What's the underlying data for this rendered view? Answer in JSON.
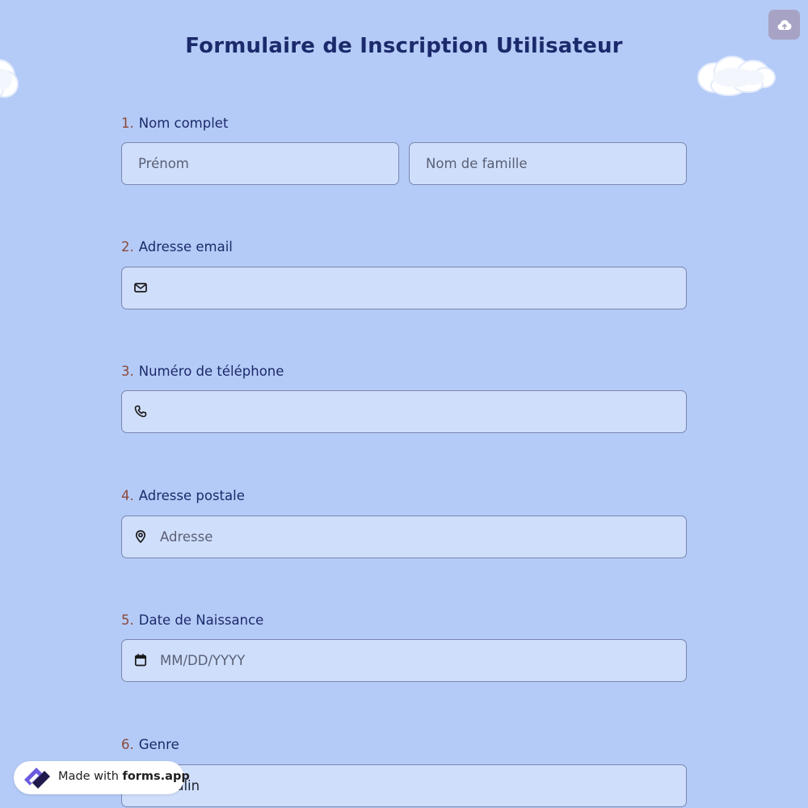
{
  "form": {
    "title": "Formulaire de Inscription Utilisateur"
  },
  "toolbar": {
    "save_icon": "cloud-upload-icon"
  },
  "questions": [
    {
      "number": "1.",
      "label": "Nom complet",
      "fields": [
        {
          "placeholder": "Prénom"
        },
        {
          "placeholder": "Nom de famille"
        }
      ]
    },
    {
      "number": "2.",
      "label": "Adresse email",
      "icon": "mail-icon",
      "placeholder": ""
    },
    {
      "number": "3.",
      "label": "Numéro de téléphone",
      "icon": "phone-icon",
      "placeholder": ""
    },
    {
      "number": "4.",
      "label": "Adresse postale",
      "icon": "map-pin-icon",
      "placeholder": "Adresse"
    },
    {
      "number": "5.",
      "label": "Date de Naissance",
      "icon": "calendar-icon",
      "placeholder": "MM/DD/YYYY"
    },
    {
      "number": "6.",
      "label": "Genre",
      "value": "Masculin"
    }
  ],
  "badge": {
    "prefix": "Made with ",
    "brand": "forms.app"
  },
  "colors": {
    "background": "#b5cbf7",
    "field_background": "#cfdefb",
    "title": "#1b2a6b",
    "number": "#8a4a3a",
    "save_button": "#a7a3c4"
  }
}
